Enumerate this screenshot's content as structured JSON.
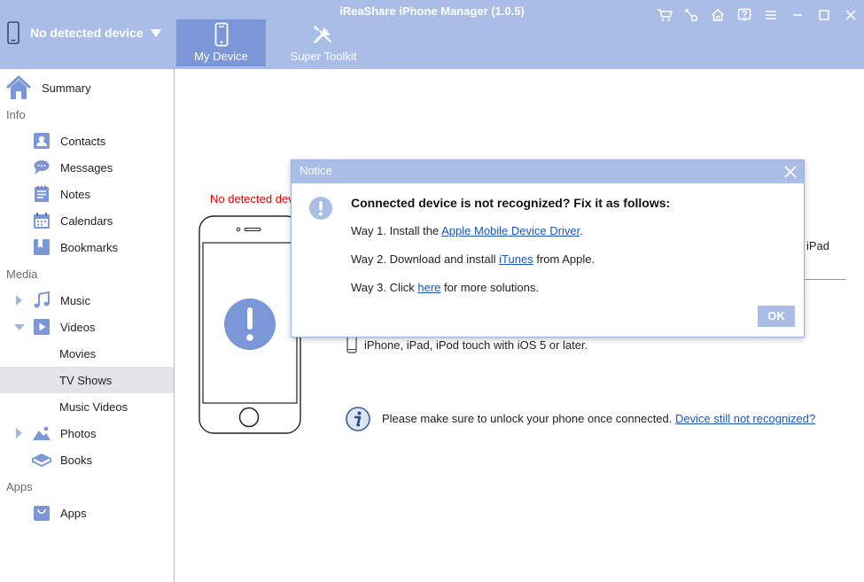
{
  "window": {
    "title": "iReaShare iPhone Manager (1.0.5)"
  },
  "device_selector": {
    "label": "No detected device"
  },
  "tabs": [
    {
      "label": "My Device",
      "active": true
    },
    {
      "label": "Super Toolkit",
      "active": false
    }
  ],
  "toolbar_icons": [
    "cart-icon",
    "key-icon",
    "home-icon",
    "help-icon",
    "menu-icon",
    "minimize-icon",
    "maximize-icon",
    "close-icon"
  ],
  "sidebar": {
    "summary": "Summary",
    "sections": {
      "info": "Info",
      "media": "Media",
      "apps": "Apps"
    },
    "items": {
      "contacts": "Contacts",
      "messages": "Messages",
      "notes": "Notes",
      "calendars": "Calendars",
      "bookmarks": "Bookmarks",
      "music": "Music",
      "videos": "Videos",
      "movies": "Movies",
      "tv_shows": "TV Shows",
      "music_videos": "Music Videos",
      "photos": "Photos",
      "books": "Books",
      "apps": "Apps"
    },
    "selected": "TV Shows"
  },
  "main": {
    "no_detected": "No detected dev",
    "ipad_fragment": "iPad",
    "requirement": "iPhone, iPad, iPod touch with iOS 5 or later.",
    "unlock_text": "Please make sure to unlock your phone once connected.",
    "unlock_link": "Device still not recognized?"
  },
  "dialog": {
    "title": "Notice",
    "heading": "Connected device is not recognized? Fix it as follows:",
    "way1_prefix": "Way 1. Install the ",
    "way1_link": "Apple Mobile Device Driver",
    "way1_suffix": ".",
    "way2_prefix": "Way 2. Download and install ",
    "way2_link": "iTunes",
    "way2_suffix": " from Apple.",
    "way3_prefix": "Way 3. Click ",
    "way3_link": "here",
    "way3_suffix": " for more solutions.",
    "ok_label": "OK"
  },
  "colors": {
    "header_bg": "#a9bde6",
    "tab_active_bg": "#7b97d8",
    "accent_icon": "#7b97d8",
    "error_text": "#e00000",
    "link": "#1a56b8",
    "sidebar_selected": "#e2e4e9"
  }
}
